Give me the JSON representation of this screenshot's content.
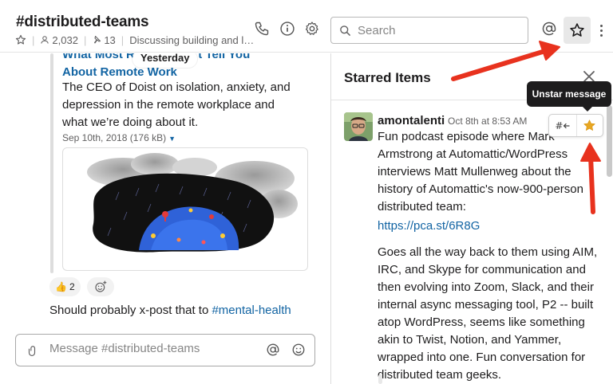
{
  "channel": {
    "name": "#distributed-teams",
    "members": "2,032",
    "pins": "13",
    "topic": "Discussing building and le..."
  },
  "search": {
    "placeholder": "Search"
  },
  "icons": {
    "star": "star-icon",
    "member": "person-icon",
    "pin": "pin-icon",
    "phone": "phone-icon",
    "info": "info-icon",
    "settings": "gear-icon",
    "mentions": "at-icon",
    "starred": "star-icon",
    "more": "more-vertical-icon",
    "search": "search-icon"
  },
  "messages": {
    "link_title_line1": "What Most R  anies Don't Tell You",
    "link_title_line2": "About Remote Work",
    "date_divider": "Yesterday",
    "link_description": "The CEO of Doist on isolation, anxiety, and depression in the remote workplace and what we’re doing about it.",
    "file_meta": "Sep 10th, 2018 (176 kB)",
    "reaction": {
      "emoji": "👍",
      "count": "2"
    },
    "text_prefix": "Should probably x-post that to ",
    "channel_link": "#mental-health"
  },
  "composer": {
    "placeholder": "Message #distributed-teams"
  },
  "starred_panel": {
    "title": "Starred Items",
    "item": {
      "author": "amontalenti",
      "timestamp": "Oct 8th at 8:53 AM",
      "text": "Fun podcast episode where Mark Armstrong at Automattic/WordPress interviews Matt Mullenweg about the history of Automattic's now-900-person distributed team:",
      "link": "https://pca.st/6R8G",
      "text2": "Goes all the way back to them using AIM, IRC, and Skype for communication and then evolving into Zoom, Slack, and their internal async messaging tool, P2 -- built atop WordPress, seems like something akin to Twist, Notion, and Yammer, wrapped into one. Fun conversation for distributed team geeks."
    },
    "tooltip": "Unstar message"
  },
  "colors": {
    "link": "#1264a3",
    "star_gold": "#e8a723",
    "arrow_red": "#e8321e"
  }
}
